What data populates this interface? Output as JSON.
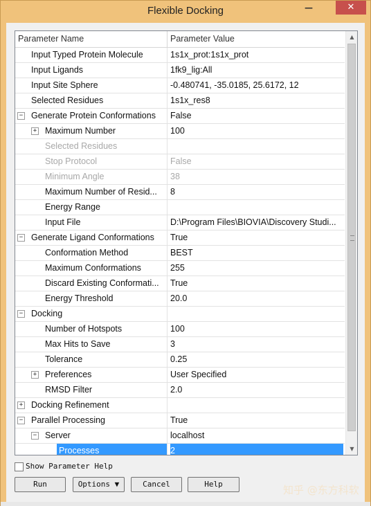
{
  "window": {
    "title": "Flexible Docking",
    "minimize_glyph": "—",
    "close_glyph": "✕"
  },
  "grid": {
    "header": {
      "name": "Parameter Name",
      "value": "Parameter Value"
    },
    "rows": [
      {
        "name": "Input Typed Protein Molecule",
        "value": "1s1x_prot:1s1x_prot",
        "level": 1,
        "toggle": "",
        "disabled": false,
        "selected": false
      },
      {
        "name": "Input Ligands",
        "value": "1fk9_lig:All",
        "level": 1,
        "toggle": "",
        "disabled": false,
        "selected": false
      },
      {
        "name": "Input Site Sphere",
        "value": "-0.480741, -35.0185, 25.6172, 12",
        "level": 1,
        "toggle": "",
        "disabled": false,
        "selected": false
      },
      {
        "name": "Selected Residues",
        "value": "1s1x_res8",
        "level": 1,
        "toggle": "",
        "disabled": false,
        "selected": false
      },
      {
        "name": "Generate Protein Conformations",
        "value": "False",
        "level": 1,
        "toggle": "−",
        "disabled": false,
        "selected": false
      },
      {
        "name": "Maximum Number",
        "value": "100",
        "level": 2,
        "toggle": "+",
        "disabled": false,
        "selected": false
      },
      {
        "name": "Selected Residues",
        "value": "",
        "level": 2,
        "toggle": "",
        "disabled": true,
        "selected": false
      },
      {
        "name": "Stop Protocol",
        "value": "False",
        "level": 2,
        "toggle": "",
        "disabled": true,
        "selected": false
      },
      {
        "name": "Minimum Angle",
        "value": "38",
        "level": 2,
        "toggle": "",
        "disabled": true,
        "selected": false
      },
      {
        "name": "Maximum Number of Resid...",
        "value": "8",
        "level": 2,
        "toggle": "",
        "disabled": false,
        "selected": false
      },
      {
        "name": "Energy Range",
        "value": "",
        "level": 2,
        "toggle": "",
        "disabled": false,
        "selected": false
      },
      {
        "name": "Input File",
        "value": "D:\\Program Files\\BIOVIA\\Discovery Studi...",
        "level": 2,
        "toggle": "",
        "disabled": false,
        "selected": false
      },
      {
        "name": "Generate Ligand Conformations",
        "value": "True",
        "level": 1,
        "toggle": "−",
        "disabled": false,
        "selected": false
      },
      {
        "name": "Conformation Method",
        "value": "BEST",
        "level": 2,
        "toggle": "",
        "disabled": false,
        "selected": false
      },
      {
        "name": "Maximum Conformations",
        "value": "255",
        "level": 2,
        "toggle": "",
        "disabled": false,
        "selected": false
      },
      {
        "name": "Discard Existing Conformati...",
        "value": "True",
        "level": 2,
        "toggle": "",
        "disabled": false,
        "selected": false
      },
      {
        "name": "Energy Threshold",
        "value": "20.0",
        "level": 2,
        "toggle": "",
        "disabled": false,
        "selected": false
      },
      {
        "name": "Docking",
        "value": "",
        "level": 1,
        "toggle": "−",
        "disabled": false,
        "selected": false
      },
      {
        "name": "Number of Hotspots",
        "value": "100",
        "level": 2,
        "toggle": "",
        "disabled": false,
        "selected": false
      },
      {
        "name": "Max Hits to Save",
        "value": "3",
        "level": 2,
        "toggle": "",
        "disabled": false,
        "selected": false
      },
      {
        "name": "Tolerance",
        "value": "0.25",
        "level": 2,
        "toggle": "",
        "disabled": false,
        "selected": false
      },
      {
        "name": "Preferences",
        "value": "User Specified",
        "level": 2,
        "toggle": "+",
        "disabled": false,
        "selected": false
      },
      {
        "name": "RMSD Filter",
        "value": "2.0",
        "level": 2,
        "toggle": "",
        "disabled": false,
        "selected": false
      },
      {
        "name": "Docking Refinement",
        "value": "",
        "level": 1,
        "toggle": "+",
        "disabled": false,
        "selected": false
      },
      {
        "name": "Parallel Processing",
        "value": "True",
        "level": 1,
        "toggle": "−",
        "disabled": false,
        "selected": false
      },
      {
        "name": "Server",
        "value": "localhost",
        "level": 2,
        "toggle": "−",
        "disabled": false,
        "selected": false
      },
      {
        "name": "Processes",
        "value": "2",
        "level": 3,
        "toggle": "",
        "disabled": false,
        "selected": true
      }
    ]
  },
  "options": {
    "show_help_label": "Show Parameter Help",
    "show_help_checked": false
  },
  "buttons": {
    "run": "Run",
    "options": "Options ▼",
    "cancel": "Cancel",
    "help": "Help"
  },
  "watermark": "知乎 @东方科软",
  "colors": {
    "window_frame": "#f0c27b",
    "selection": "#3399ff",
    "close_button": "#c7504c"
  }
}
